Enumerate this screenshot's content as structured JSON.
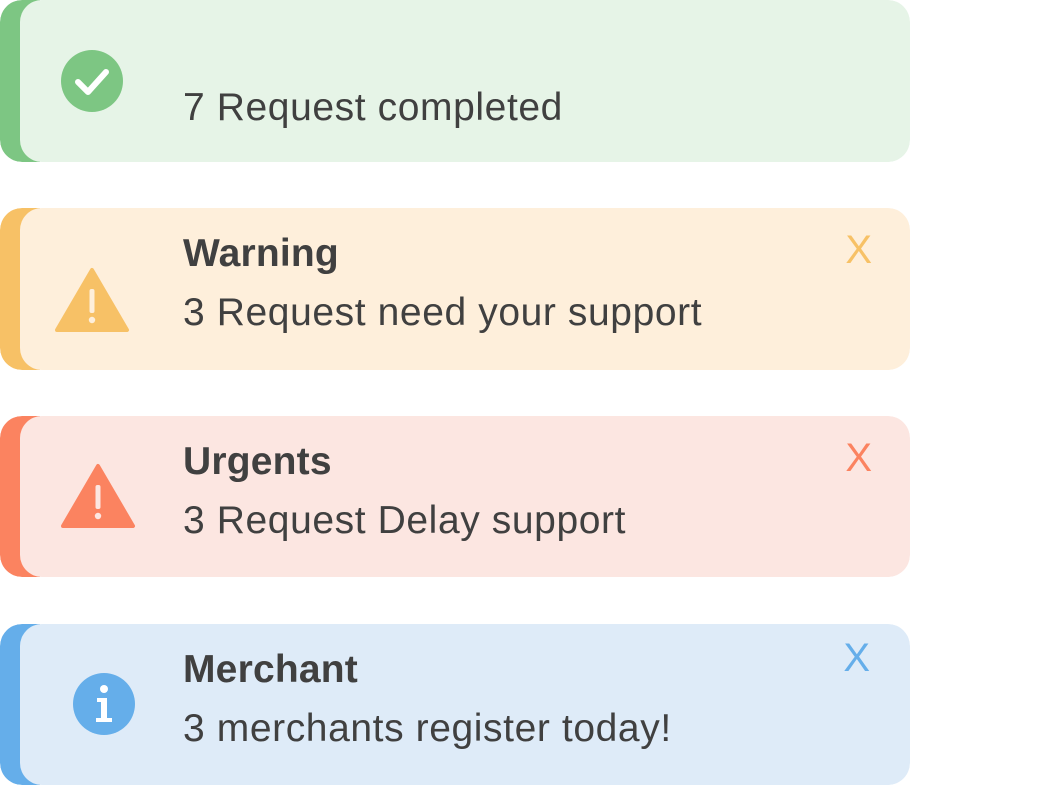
{
  "alerts": {
    "success": {
      "title": "",
      "message": "7 Request completed",
      "icon": "check-circle-icon",
      "accent_color": "#7dc683",
      "background_color": "#e6f4e7"
    },
    "warning": {
      "title": "Warning",
      "message": "3 Request need your support",
      "icon": "warning-triangle-icon",
      "close_label": "X",
      "accent_color": "#f7c166",
      "background_color": "#feefdb"
    },
    "urgent": {
      "title": "Urgents",
      "message": "3 Request Delay support",
      "icon": "alert-triangle-icon",
      "close_label": "X",
      "accent_color": "#fb8360",
      "background_color": "#fce6e1"
    },
    "info": {
      "title": "Merchant",
      "message": "3 merchants register today!",
      "icon": "info-circle-icon",
      "close_label": "X",
      "accent_color": "#65aeea",
      "background_color": "#deebf8"
    }
  }
}
